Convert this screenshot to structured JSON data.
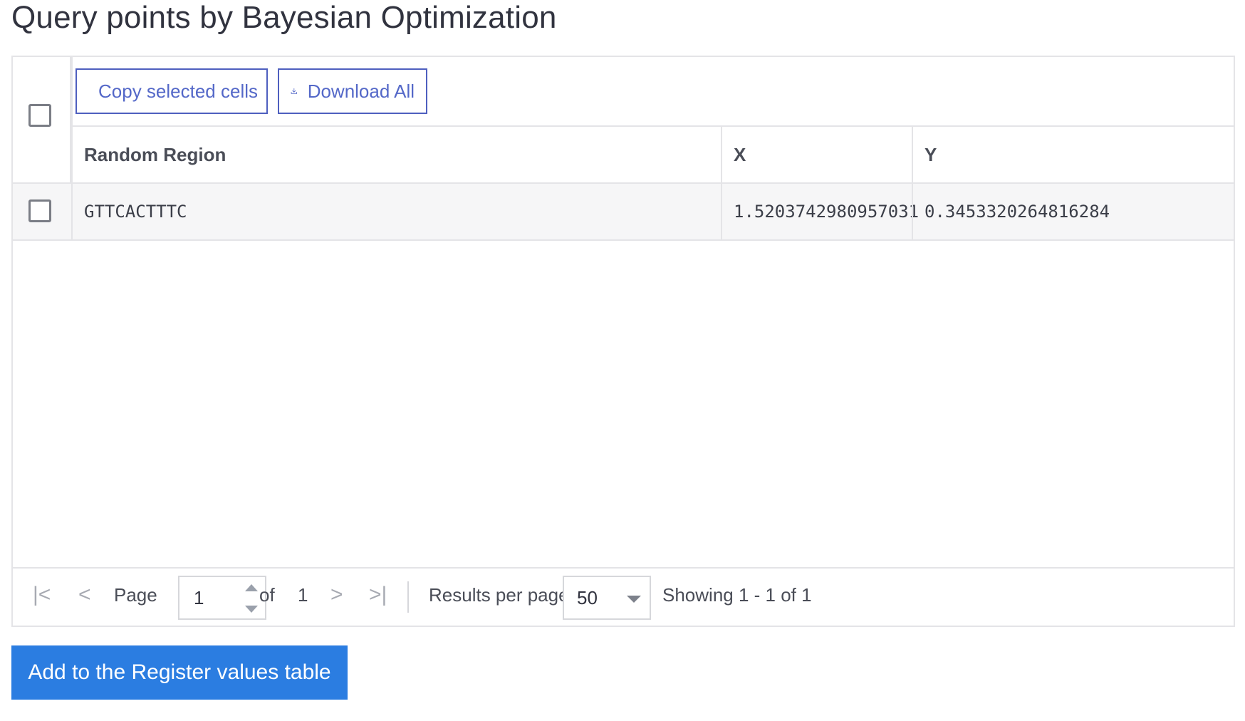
{
  "title": "Query points by Bayesian Optimization",
  "toolbar": {
    "copy_label": "Copy selected cells",
    "copy_icon": "clipboard-icon",
    "download_label": "Download All",
    "download_icon": "download-icon"
  },
  "table": {
    "columns": [
      "Random Region",
      "X",
      "Y"
    ],
    "rows": [
      [
        "GTTCACTTTC",
        "1.5203742980957031",
        "0.3453320264816284"
      ]
    ]
  },
  "pagination": {
    "page_label": "Page",
    "page_value": "1",
    "of_label": "of",
    "total_pages": "1",
    "results_per_page_label": "Results per page",
    "results_per_page_value": "50",
    "showing": "Showing 1 - 1 of 1",
    "icons": [
      "first-page-icon",
      "prev-page-icon",
      "next-page-icon",
      "last-page-icon"
    ]
  },
  "actions": {
    "add_label": "Add to the Register values table"
  },
  "colors": {
    "primary": "#2b7de1",
    "outline_button": "#4e5fbf",
    "border": "#e4e4e7",
    "row_bg": "#f6f6f7"
  }
}
